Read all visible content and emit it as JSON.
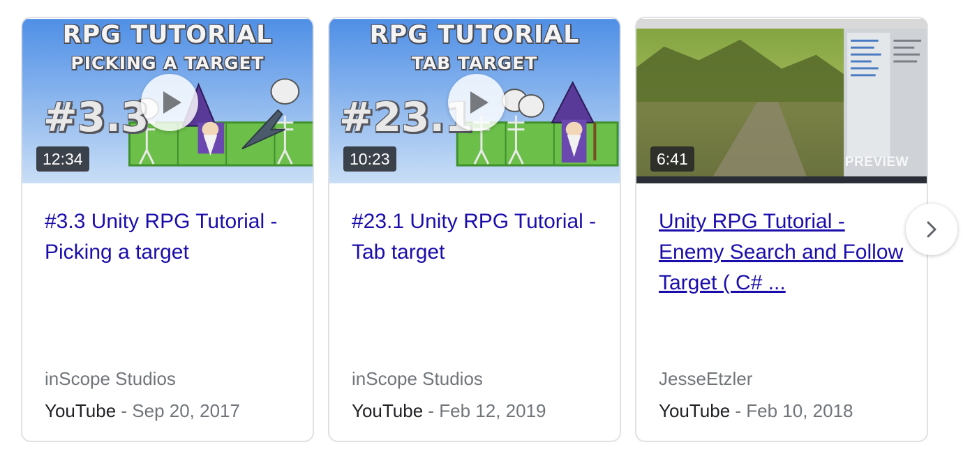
{
  "cards": [
    {
      "thumbnail": {
        "line1": "RPG TUTORIAL",
        "line2": "PICKING A TARGET",
        "episode": "#3.3"
      },
      "duration": "12:34",
      "title": "#3.3 Unity RPG Tutorial - Picking a target",
      "channel": "inScope Studios",
      "source": "YouTube",
      "separator": " - ",
      "date": "Sep 20, 2017"
    },
    {
      "thumbnail": {
        "line1": "RPG TUTORIAL",
        "line2": "TAB TARGET",
        "episode": "#23.1"
      },
      "duration": "10:23",
      "title": "#23.1 Unity RPG Tutorial - Tab target",
      "channel": "inScope Studios",
      "source": "YouTube",
      "separator": " - ",
      "date": "Feb 12, 2019"
    },
    {
      "thumbnail": {
        "preview_label": "PREVIEW"
      },
      "duration": "6:41",
      "title": "Unity RPG Tutorial - Enemy Search and Follow Target ( C# ...",
      "channel": "JesseEtzler",
      "source": "YouTube",
      "separator": " - ",
      "date": "Feb 10, 2018"
    }
  ],
  "icons": {
    "play": "play-icon",
    "next": "chevron-right-icon"
  },
  "colors": {
    "title_link": "#1a0dab",
    "secondary_text": "#70757a",
    "source_text": "#202124",
    "card_border": "#dfe1e5"
  }
}
